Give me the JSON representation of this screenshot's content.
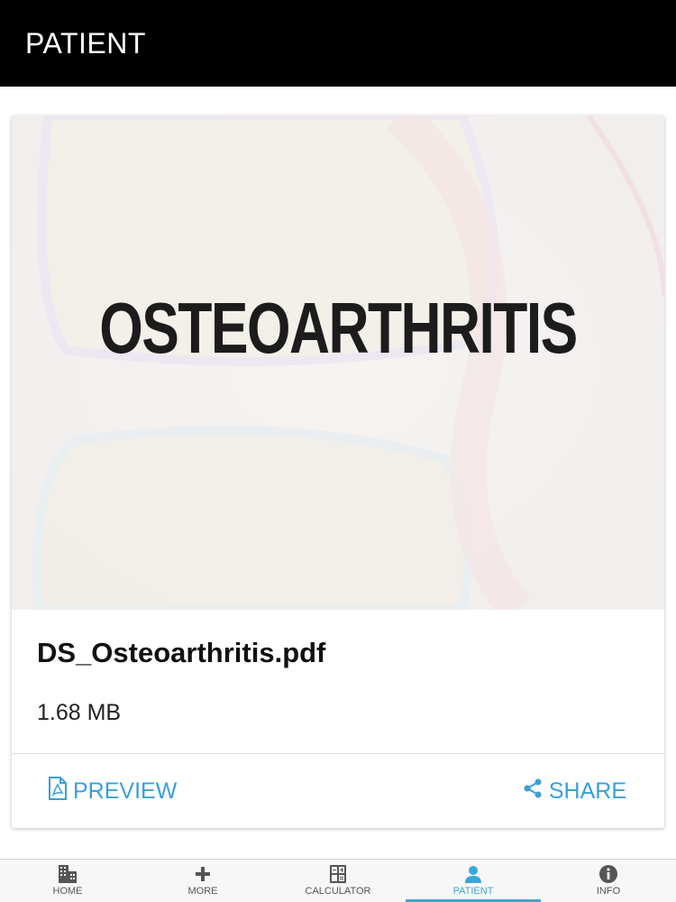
{
  "header": {
    "title": "PATIENT"
  },
  "document": {
    "cover_title": "OSTEOARTHRITIS",
    "file_name": "DS_Osteoarthritis.pdf",
    "file_size": "1.68 MB"
  },
  "actions": {
    "preview_label": "PREVIEW",
    "share_label": "SHARE"
  },
  "tabs": [
    {
      "label": "HOME",
      "icon": "building-icon",
      "active": false
    },
    {
      "label": "MORE",
      "icon": "plus-icon",
      "active": false
    },
    {
      "label": "CALCULATOR",
      "icon": "calculator-icon",
      "active": false
    },
    {
      "label": "PATIENT",
      "icon": "person-icon",
      "active": true
    },
    {
      "label": "INFO",
      "icon": "info-icon",
      "active": false
    }
  ],
  "colors": {
    "accent": "#3ba7d9",
    "topbar": "#000000"
  }
}
